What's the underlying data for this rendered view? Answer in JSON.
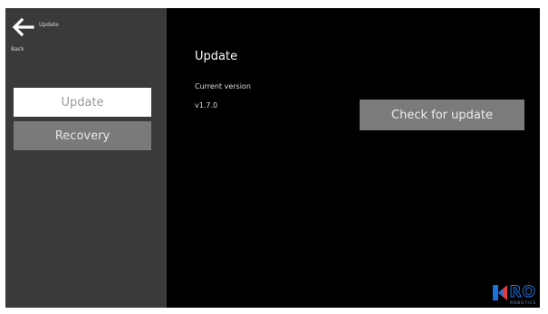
{
  "header": {
    "title": "Update",
    "back_label": "Back"
  },
  "sidebar": {
    "items": [
      {
        "label": "Update",
        "selected": true
      },
      {
        "label": "Recovery",
        "selected": false
      }
    ]
  },
  "main": {
    "title": "Update",
    "current_version_label": "Current version",
    "current_version_value": "v1.7.0",
    "check_button_label": "Check for update"
  },
  "logo": {
    "text": "RO",
    "subtext": "ROBOTICS"
  },
  "colors": {
    "background": "#000000",
    "sidebar": "#3a3a3a",
    "button": "#7b7b7b",
    "selected": "#ffffff",
    "logo_blue": "#1e6fd9",
    "logo_red": "#e23b3b"
  },
  "icons": {
    "back": "arrow-left-icon",
    "logo": "brand-logo-icon"
  }
}
